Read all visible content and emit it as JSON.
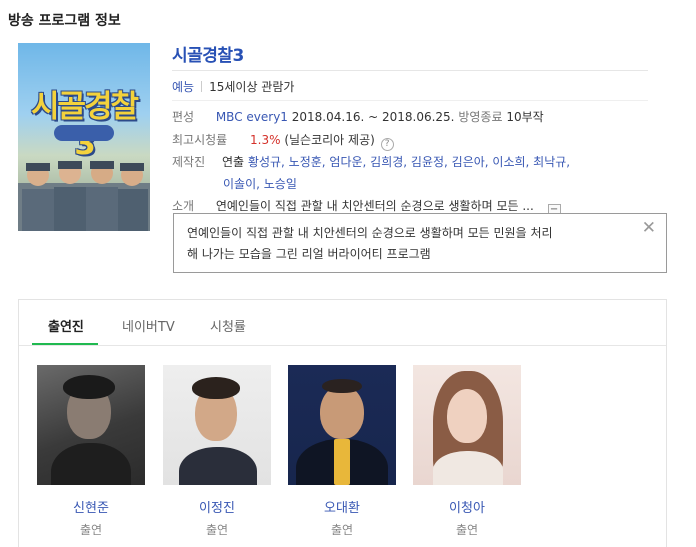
{
  "section_title": "방송 프로그램 정보",
  "poster": {
    "logo_text": "시골경찰3"
  },
  "program": {
    "title": "시골경찰3",
    "genre": "예능",
    "age_rating": "15세이상 관람가",
    "broadcast_label": "편성",
    "channel": "MBC every1",
    "period": "2018.04.16. ~ 2018.06.25.",
    "status": "방영종료",
    "episodes": "10부작",
    "top_rating_label": "최고시청률",
    "top_rating": "1.3%",
    "rating_source": "(닐슨코리아 제공)",
    "help_icon": "?",
    "staff_label": "제작진",
    "staff_role": "연출",
    "staff_line1": "황성규, 노정훈, 엄다운, 김희경, 김윤정, 김은아, 이소희, 최낙규,",
    "staff_line2": "이솔이, 노승일",
    "intro_label": "소개",
    "intro_short": "연예인들이 직접 관할 내 치안센터의 순경으로 생활하며 모든 ...",
    "fold_icon": "−"
  },
  "popup": {
    "line1": "연예인들이 직접 관할 내 치안센터의 순경으로 생활하며 모든 민원을 처리",
    "line2": "해 나가는 모습을 그린 리얼 버라이어티 프로그램",
    "close": "✕"
  },
  "tabs": [
    {
      "label": "출연진"
    },
    {
      "label": "네이버TV"
    },
    {
      "label": "시청률"
    }
  ],
  "cast": [
    {
      "name": "신현준",
      "role": "출연"
    },
    {
      "name": "이정진",
      "role": "출연"
    },
    {
      "name": "오대환",
      "role": "출연"
    },
    {
      "name": "이청아",
      "role": "출연"
    }
  ],
  "colors": {
    "link": "#3857b3",
    "title": "#2851b5",
    "accent_tab": "#20b950",
    "rating": "#d4312a"
  }
}
